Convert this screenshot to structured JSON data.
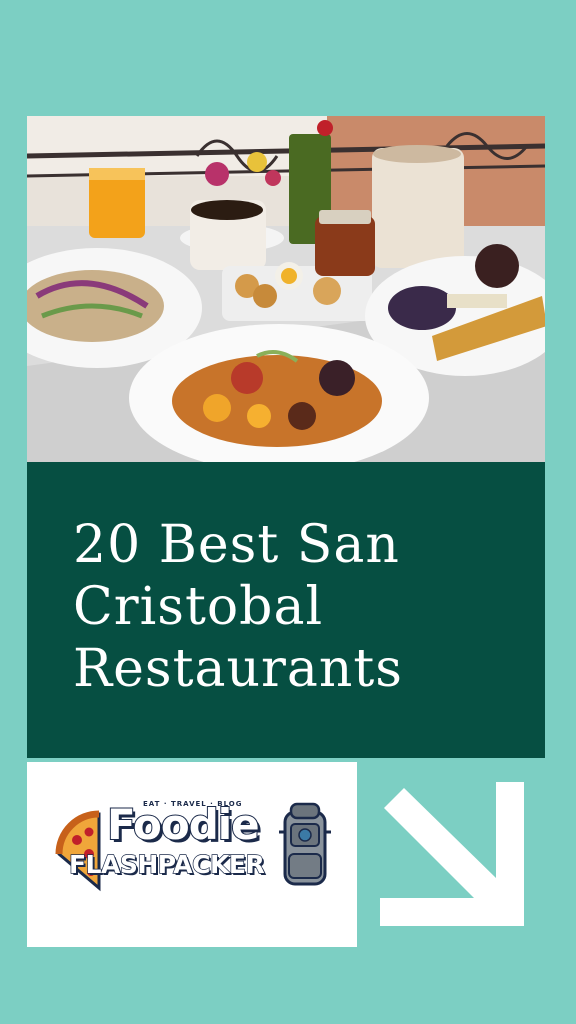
{
  "card": {
    "title_line1": "20 Best San",
    "title_line2": "Cristobal",
    "title_line3": "Restaurants"
  },
  "logo": {
    "tagline": "EAT · TRAVEL · BLOG",
    "word1": "Foodie",
    "word2": "FLASHPACKER"
  },
  "icons": {
    "arrow": "arrow-down-right-icon",
    "pizza": "pizza-icon",
    "backpack": "backpack-icon"
  },
  "colors": {
    "background": "#7ccfc3",
    "title_panel": "#064f42",
    "title_text": "#ffffff",
    "logo_navy": "#1b2a4a"
  }
}
